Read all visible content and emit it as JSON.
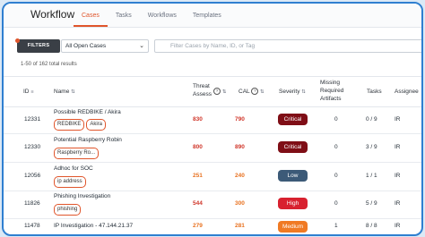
{
  "app": {
    "title": "Workflow"
  },
  "tabs": [
    {
      "label": "Cases",
      "active": true
    },
    {
      "label": "Tasks"
    },
    {
      "label": "Workflows"
    },
    {
      "label": "Templates"
    }
  ],
  "filters": {
    "button_label": "FILTERS",
    "select_value": "All Open Cases",
    "search_placeholder": "Filter Cases by Name, ID, or Tag"
  },
  "results_text": "1-50 of 162 total results",
  "columns": {
    "id": "ID",
    "name": "Name",
    "threat_line1": "Threat",
    "threat_line2": "Assess",
    "cal": "CAL",
    "severity": "Severity",
    "missing_line1": "Missing",
    "missing_line2": "Required",
    "missing_line3": "Artifacts",
    "tasks": "Tasks",
    "assignee": "Assignee"
  },
  "rows": [
    {
      "id": "12331",
      "name": "Possible REDBIKE / Akira",
      "tags": [
        "REDBIKE",
        "Akira"
      ],
      "threat": "830",
      "cal": "790",
      "severity": "Critical",
      "missing": "0",
      "tasks": "0 / 9",
      "assignee": "IR"
    },
    {
      "id": "12330",
      "name": "Potential Raspberry Robin",
      "tags": [
        "Raspberry Ro..."
      ],
      "threat": "800",
      "cal": "890",
      "severity": "Critical",
      "missing": "0",
      "tasks": "3 / 9",
      "assignee": "IR"
    },
    {
      "id": "12056",
      "name": "Adhoc for SOC",
      "tags": [
        "ip address"
      ],
      "threat": "251",
      "cal": "240",
      "severity": "Low",
      "missing": "0",
      "tasks": "1 / 1",
      "assignee": "IR"
    },
    {
      "id": "11826",
      "name": "Phishing Investigation",
      "tags": [
        "phishing"
      ],
      "threat": "544",
      "cal": "300",
      "severity": "High",
      "missing": "0",
      "tasks": "5 / 9",
      "assignee": "IR"
    },
    {
      "id": "11478",
      "name": "IP Investigation - 47.144.21.37",
      "tags": [],
      "threat": "279",
      "cal": "281",
      "severity": "Medium",
      "missing": "1",
      "tasks": "8 / 8",
      "assignee": "IR"
    }
  ],
  "colors": {
    "accent": "#e0552b",
    "critical": "#7f0e16",
    "high": "#d8212f",
    "medium": "#f07a24",
    "low": "#3c5a78",
    "border": "#2f7fd0"
  }
}
